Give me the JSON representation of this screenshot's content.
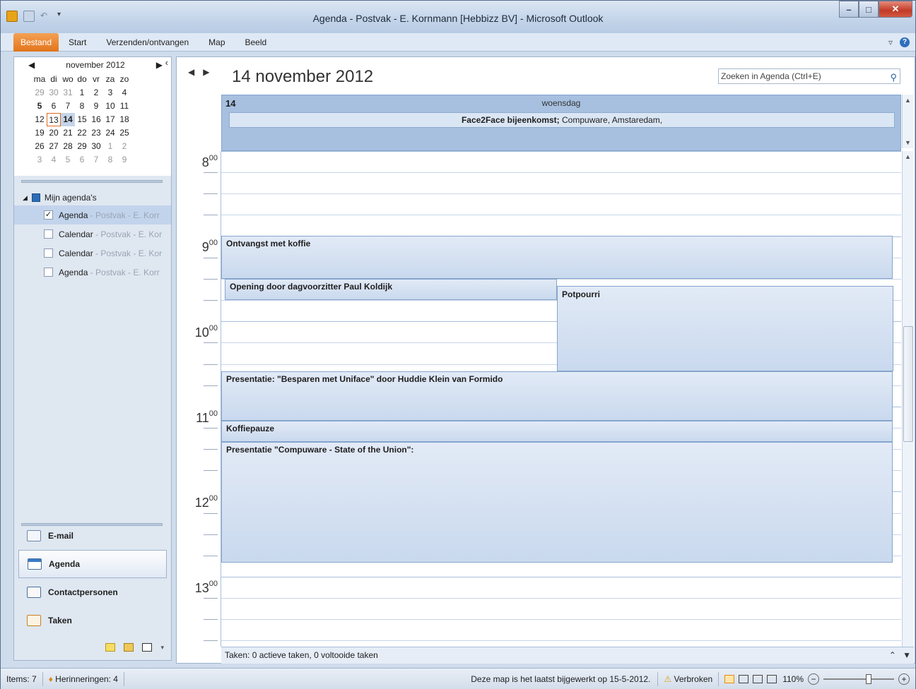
{
  "window": {
    "title": "Agenda - Postvak - E. Kornmann [Hebbizz BV] - Microsoft Outlook"
  },
  "ribbon": {
    "tabs": [
      "Bestand",
      "Start",
      "Verzenden/ontvangen",
      "Map",
      "Beeld"
    ]
  },
  "mini_calendar": {
    "month_label": "november 2012",
    "weekdays": [
      "ma",
      "di",
      "wo",
      "do",
      "vr",
      "za",
      "zo"
    ],
    "weeks": [
      [
        "29",
        "30",
        "31",
        "1",
        "2",
        "3",
        "4"
      ],
      [
        "5",
        "6",
        "7",
        "8",
        "9",
        "10",
        "11"
      ],
      [
        "12",
        "13",
        "14",
        "15",
        "16",
        "17",
        "18"
      ],
      [
        "19",
        "20",
        "21",
        "22",
        "23",
        "24",
        "25"
      ],
      [
        "26",
        "27",
        "28",
        "29",
        "30",
        "1",
        "2"
      ],
      [
        "3",
        "4",
        "5",
        "6",
        "7",
        "8",
        "9"
      ]
    ],
    "today": "13",
    "selected": "14"
  },
  "calendars": {
    "group_label": "Mijn agenda's",
    "items": [
      {
        "name": "Agenda",
        "sub": " - Postvak - E. Korr",
        "checked": true
      },
      {
        "name": "Calendar",
        "sub": " - Postvak - E. Kor",
        "checked": false
      },
      {
        "name": "Calendar",
        "sub": " - Postvak - E. Kor",
        "checked": false
      },
      {
        "name": "Agenda",
        "sub": " - Postvak - E. Korr",
        "checked": false
      }
    ]
  },
  "nav_buttons": [
    {
      "label": "E-mail",
      "icon": "mail-icon"
    },
    {
      "label": "Agenda",
      "icon": "calendar-icon",
      "active": true
    },
    {
      "label": "Contactpersonen",
      "icon": "contacts-icon"
    },
    {
      "label": "Taken",
      "icon": "tasks-icon"
    }
  ],
  "main": {
    "date_title": "14 november 2012",
    "search_placeholder": "Zoeken in Agenda (Ctrl+E)",
    "day_number": "14",
    "day_name": "woensdag",
    "allday_event_title": "Face2Face bijeenkomst;",
    "allday_event_location": " Compuware, Amstaredam,",
    "hours": [
      {
        "h": "8",
        "m": "00"
      },
      {
        "h": "9",
        "m": "00"
      },
      {
        "h": "10",
        "m": "00"
      },
      {
        "h": "11",
        "m": "00"
      },
      {
        "h": "12",
        "m": "00"
      },
      {
        "h": "13",
        "m": "00"
      }
    ],
    "appointments": [
      {
        "title": "Ontvangst met koffie"
      },
      {
        "title": "Opening door dagvoorzitter Paul Koldijk"
      },
      {
        "title": "Potpourri"
      },
      {
        "title": "Presentatie: \"Besparen met Uniface\" door Huddie Klein van Formido"
      },
      {
        "title": "Koffiepauze"
      },
      {
        "title": "Presentatie \"Compuware - State of the Union\":"
      }
    ],
    "tasks_bar": "Taken: 0 actieve taken, 0 voltooide taken"
  },
  "status": {
    "items": "Items: 7",
    "reminders": "Herinneringen: 4",
    "message": "Deze map is het laatst bijgewerkt op 15-5-2012.",
    "connection": "Verbroken",
    "zoom": "110%"
  },
  "colors": {
    "accent": "#e2741c",
    "calendar_header": "#a7c0e0",
    "appointment": "#c9d9ee"
  }
}
